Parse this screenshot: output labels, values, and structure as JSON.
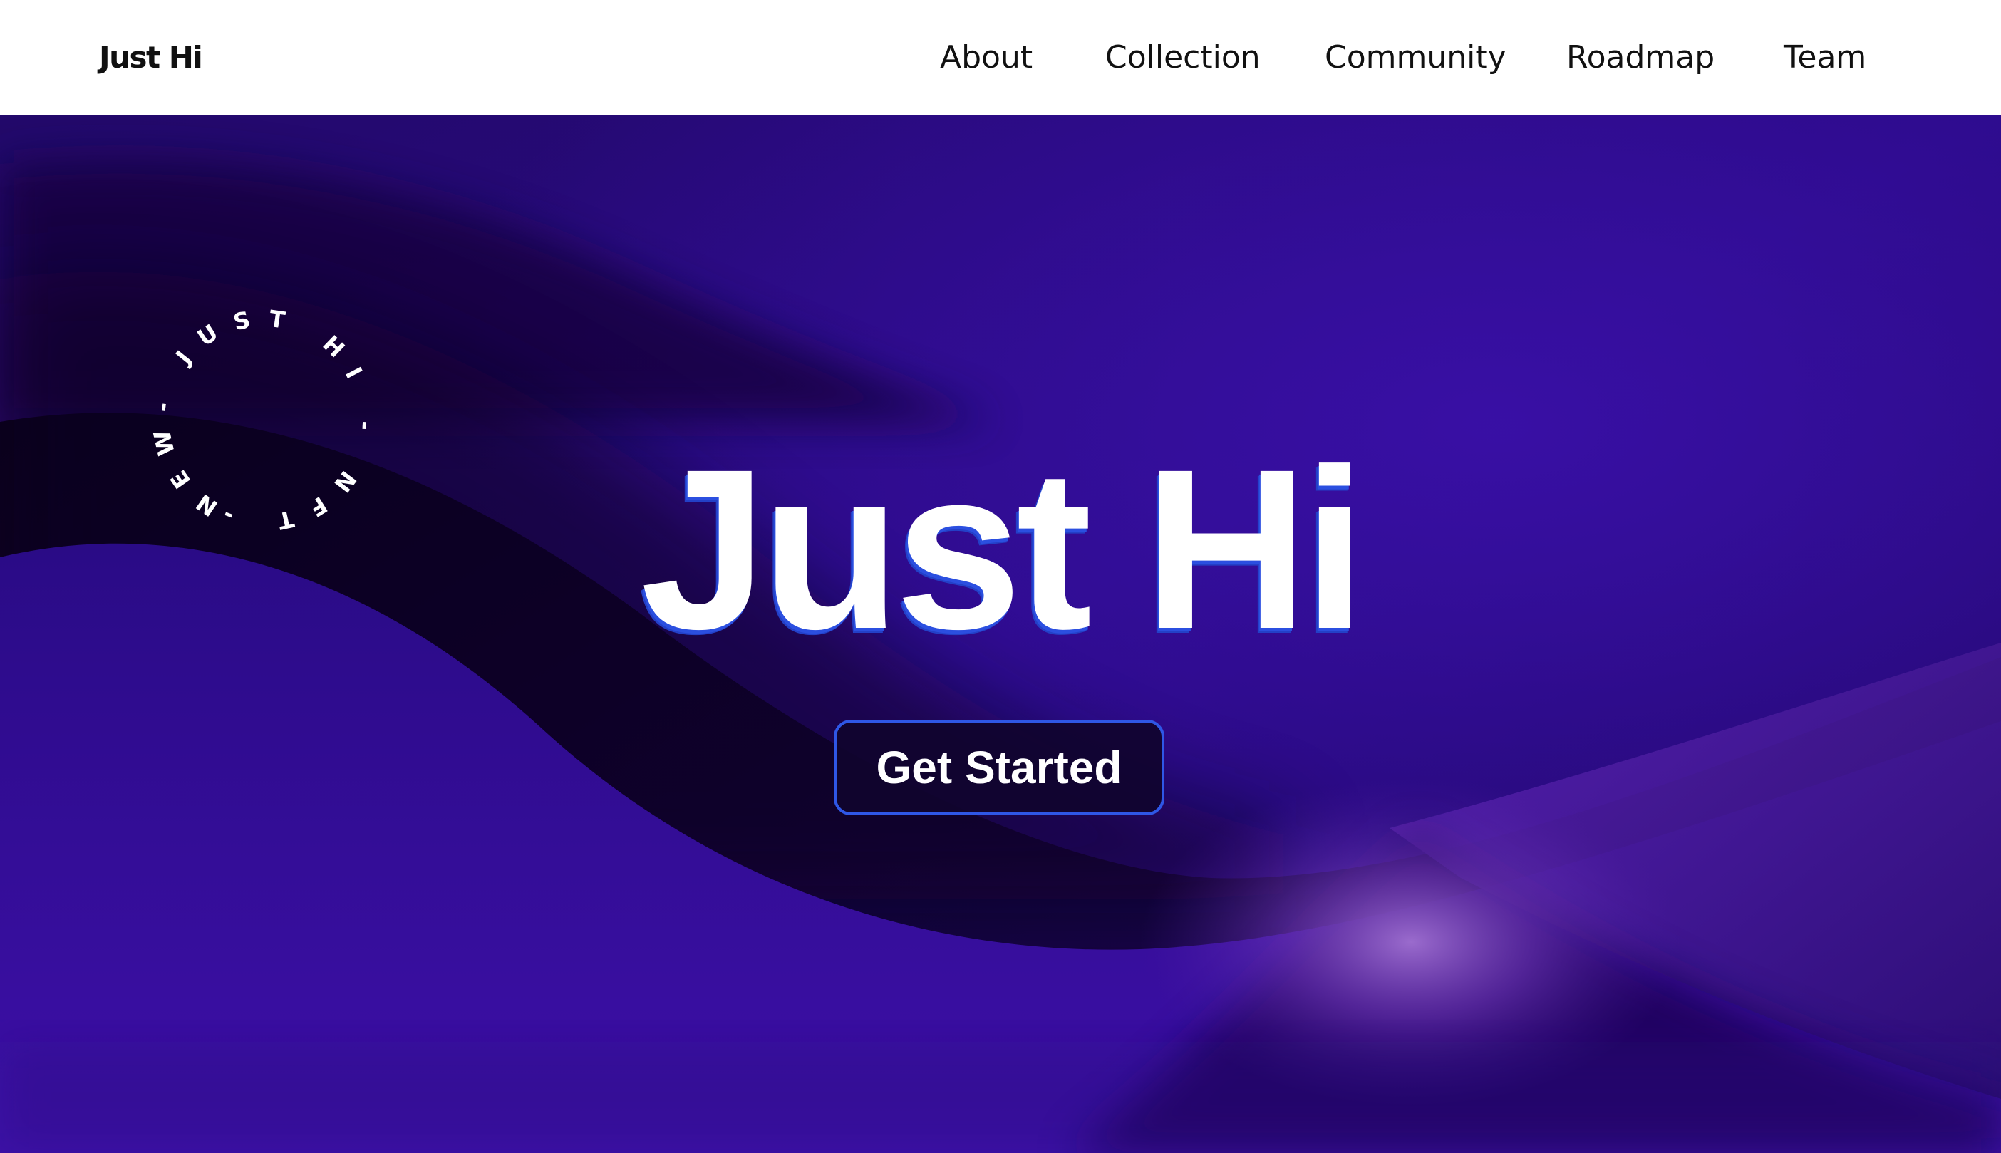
{
  "header": {
    "brand": "Just Hi",
    "nav": [
      {
        "label": "About"
      },
      {
        "label": "Collection"
      },
      {
        "label": "Community"
      },
      {
        "label": "Roadmap"
      },
      {
        "label": "Team"
      }
    ]
  },
  "hero": {
    "title": "Just Hi",
    "cta_label": "Get Started",
    "badge_text": "NEW- JUST HI - NFT -"
  },
  "colors": {
    "header_bg": "#ffffff",
    "hero_base": "#1c0758",
    "hero_dark": "#0b0224",
    "hero_highlight": "#9d6fd6",
    "cta_border": "#2f57e6",
    "title_shadow": "#2b4fe0"
  }
}
